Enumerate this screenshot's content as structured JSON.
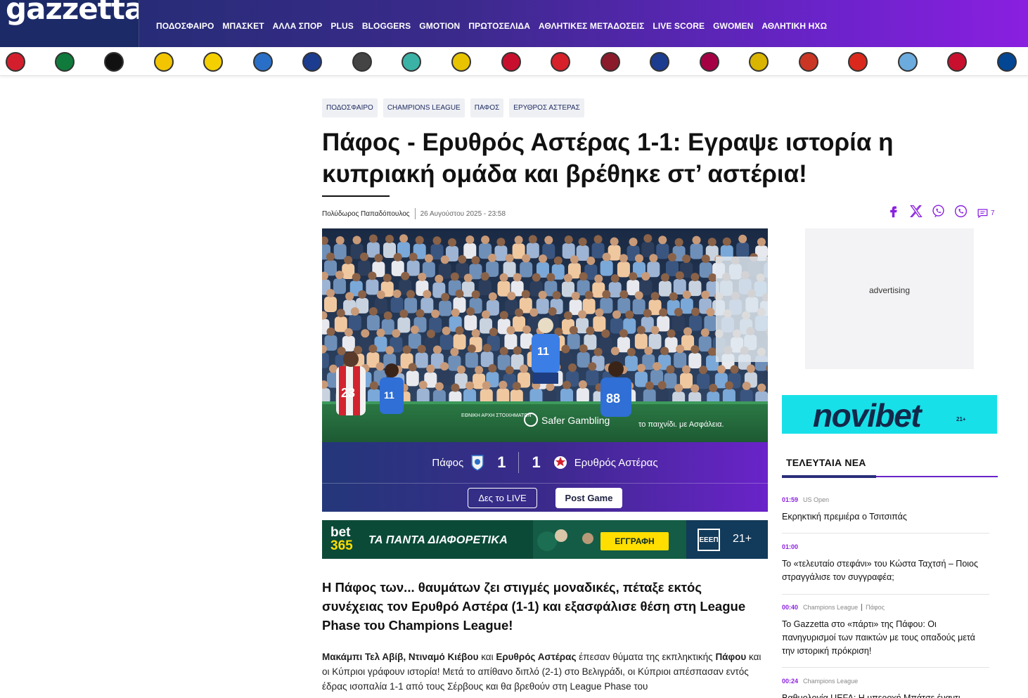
{
  "header": {
    "logo": "gazzetta",
    "nav": [
      "ΠΟΔΟΣΦΑΙΡΟ",
      "ΜΠΑΣΚΕΤ",
      "ΑΛΛΑ ΣΠΟΡ",
      "PLUS",
      "BLOGGERS",
      "GMOTION",
      "ΠΡΩΤΟΣΕΛΙΔΑ",
      "ΑΘΛΗΤΙΚΕΣ ΜΕΤΑΔΟΣΕΙΣ",
      "LIVE SCORE",
      "GWOMEN",
      "ΑΘΛΗΤΙΚΗ ΗΧΩ"
    ]
  },
  "team_crests": [
    {
      "icon": "olympiacos-crest",
      "color": "#d31f2d"
    },
    {
      "icon": "panathinaikos-crest",
      "color": "#0f7a3b"
    },
    {
      "icon": "paok-crest",
      "color": "#111111"
    },
    {
      "icon": "aek-crest",
      "color": "#f2c500"
    },
    {
      "icon": "aris-crest",
      "color": "#f5d000"
    },
    {
      "icon": "asteras-tripolis-crest",
      "color": "#2a6fc7"
    },
    {
      "icon": "atromitos-crest",
      "color": "#1b3c8f"
    },
    {
      "icon": "ofi-crest",
      "color": "#444444"
    },
    {
      "icon": "levadiakos-crest",
      "color": "#3bb2a6"
    },
    {
      "icon": "panetolikos-crest",
      "color": "#e8c400"
    },
    {
      "icon": "volos-crest",
      "color": "#c8102e"
    },
    {
      "icon": "panserraikos-crest",
      "color": "#d6202a"
    },
    {
      "icon": "larissa-crest",
      "color": "#8b1a2a"
    },
    {
      "icon": "kifisia-crest",
      "color": "#1b3c8f"
    },
    {
      "icon": "barcelona-crest",
      "color": "#a50044"
    },
    {
      "icon": "real-madrid-crest",
      "color": "#d9b400"
    },
    {
      "icon": "atletico-crest",
      "color": "#cb3524"
    },
    {
      "icon": "man-united-crest",
      "color": "#da291c"
    },
    {
      "icon": "man-city-crest",
      "color": "#6cabdd"
    },
    {
      "icon": "liverpool-crest",
      "color": "#c8102e"
    },
    {
      "icon": "chelsea-crest",
      "color": "#034694"
    }
  ],
  "article": {
    "tags": [
      "ΠΟΔΟΣΦΑΙΡΟ",
      "CHAMPIONS LEAGUE",
      "ΠΑΦΟΣ",
      "ΕΡΥΘΡΟΣ ΑΣΤΕΡΑΣ"
    ],
    "title": "Πάφος - Ερυθρός Αστέρας 1-1: Εγραψε ιστορία η κυπριακή ομάδα και βρέθηκε στ’ αστέρια!",
    "author": "Πολύδωρος Παπαδόπουλος",
    "date": "26 Αυγούστου 2025 - 23:58",
    "comment_count": "7",
    "lead": "Η Πάφος των... θαυμάτων ζει στιγμές μοναδικές, πέταξε εκτός συνέχειας τον Ερυθρό Αστέρα (1-1) και εξασφάλισε θέση στη League Phase του Champions League!",
    "body_parts": [
      {
        "b": "Μακάμπι Τελ Αβίβ, Ντιναμό Κιέβου"
      },
      {
        "t": " και "
      },
      {
        "b": "Ερυθρός Αστέρας"
      },
      {
        "t": " έπεσαν θύματα της εκπληκτικής "
      },
      {
        "b": "Πάφου"
      },
      {
        "t": " και οι Κύπριοι γράφουν ιστορία! Μετά το απίθανο διπλό (2-1) στο Βελιγράδι, οι Κύπριοι απέσπασαν εντός έδρας ισοπαλία 1-1 από τους Σέρβους και θα βρεθούν στη League Phase του"
      }
    ]
  },
  "hero": {
    "players": [
      "23",
      "11",
      "11",
      "88"
    ],
    "board_texts": [
      "ΕΘΝΙΚΗ ΑΡΧΗ ΣΤΟΙΧΗΜΑΤΩΝ",
      "Safer Gambling",
      "το παιχνίδι. με Ασφάλεια."
    ]
  },
  "match": {
    "home_team": "Πάφος",
    "home_score": "1",
    "away_score": "1",
    "away_team": "Ερυθρός Αστέρας",
    "btn_live": "Δες το LIVE",
    "btn_post": "Post Game"
  },
  "bet365": {
    "logo_top": "bet",
    "logo_bottom": "365",
    "slogan": "ΤΑ ΠΑΝΤΑ ΔΙΑΦΟΡΕΤΙΚΑ",
    "cta": "ΕΓΓΡΑΦΗ",
    "eeep": "ΕΕΕΠ",
    "age": "21+"
  },
  "sidebar": {
    "advertising": "advertising",
    "novibet": "novibet",
    "novibet_age": "21+",
    "latest_title": "ΤΕΛΕΥΤΑΙΑ ΝΕΑ",
    "news": [
      {
        "time": "01:59",
        "cat": "US Open",
        "cat2": "",
        "title": "Εκρηκτική πρεμιέρα ο Τσιτσιπάς"
      },
      {
        "time": "01:00",
        "cat": "",
        "cat2": "",
        "title": "Το «τελευταίο στεφάνι» του Κώστα Ταχτσή – Ποιος στραγγάλισε τον συγγραφέα;"
      },
      {
        "time": "00:40",
        "cat": "Champions League",
        "cat2": "Πάφος",
        "title": "Το Gazzetta στο «πάρτι» της Πάφου: Οι πανηγυρισμοί των παικτών με τους οπαδούς μετά την ιστορική πρόκριση!"
      },
      {
        "time": "00:24",
        "cat": "Champions League",
        "cat2": "",
        "title": "Βαθμολογία UEFA: Η υπεροχή Μπάτσε έναντι"
      }
    ]
  }
}
